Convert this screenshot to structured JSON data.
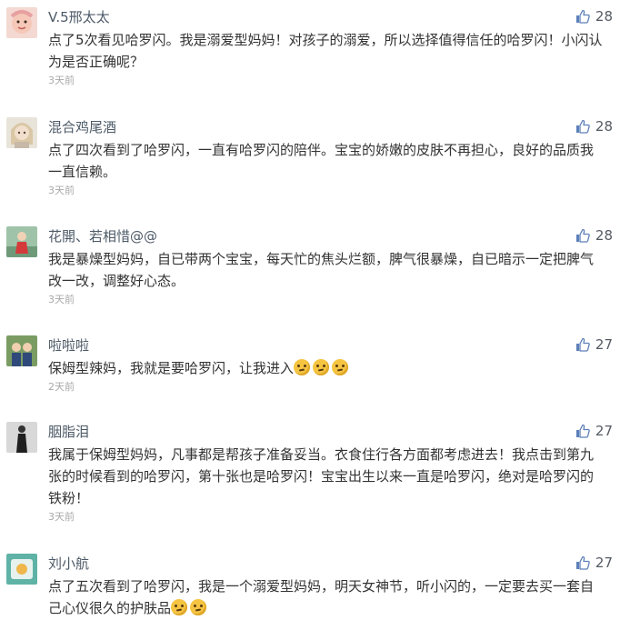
{
  "comments": [
    {
      "username": "V.5邢太太",
      "avatar": "baby-avatar",
      "likes": "28",
      "text": "点了5次看见哈罗闪。我是溺爱型妈妈！对孩子的溺爱，所以选择值得信任的哈罗闪！小闪认为是否正确呢？",
      "emoji_count": 0,
      "time": "3天前"
    },
    {
      "username": "混合鸡尾酒",
      "avatar": "doll-avatar",
      "likes": "28",
      "text": "点了四次看到了哈罗闪，一直有哈罗闪的陪伴。宝宝的娇嫩的皮肤不再担心，良好的品质我一直信赖。",
      "emoji_count": 0,
      "time": "3天前"
    },
    {
      "username": "花開、若相惜@@",
      "avatar": "person-red-avatar",
      "likes": "28",
      "text": "我是暴燥型妈妈，自已带两个宝宝，每天忙的焦头烂额，脾气很暴燥，自已暗示一定把脾气改一改，调整好心态。",
      "emoji_count": 0,
      "time": "3天前"
    },
    {
      "username": "啦啦啦",
      "avatar": "kids-avatar",
      "likes": "27",
      "text": "保姆型辣妈，我就是要哈罗闪，让我进入",
      "emoji_count": 3,
      "time": "2天前"
    },
    {
      "username": "胭脂泪",
      "avatar": "dark-figure-avatar",
      "likes": "27",
      "text": "我属于保姆型妈妈，凡事都是帮孩子准备妥当。衣食住行各方面都考虑进去！我点击到第九张的时候看到的哈罗闪，第十张也是哈罗闪！宝宝出生以来一直是哈罗闪，绝对是哈罗闪的铁粉！",
      "emoji_count": 0,
      "time": "3天前"
    },
    {
      "username": "刘小航",
      "avatar": "teal-avatar",
      "likes": "27",
      "text": "点了五次看到了哈罗闪，我是一个溺爱型妈妈，明天女神节，听小闪的，一定要去买一套自己心仪很久的护肤品",
      "emoji_count": 2,
      "time": ""
    }
  ]
}
